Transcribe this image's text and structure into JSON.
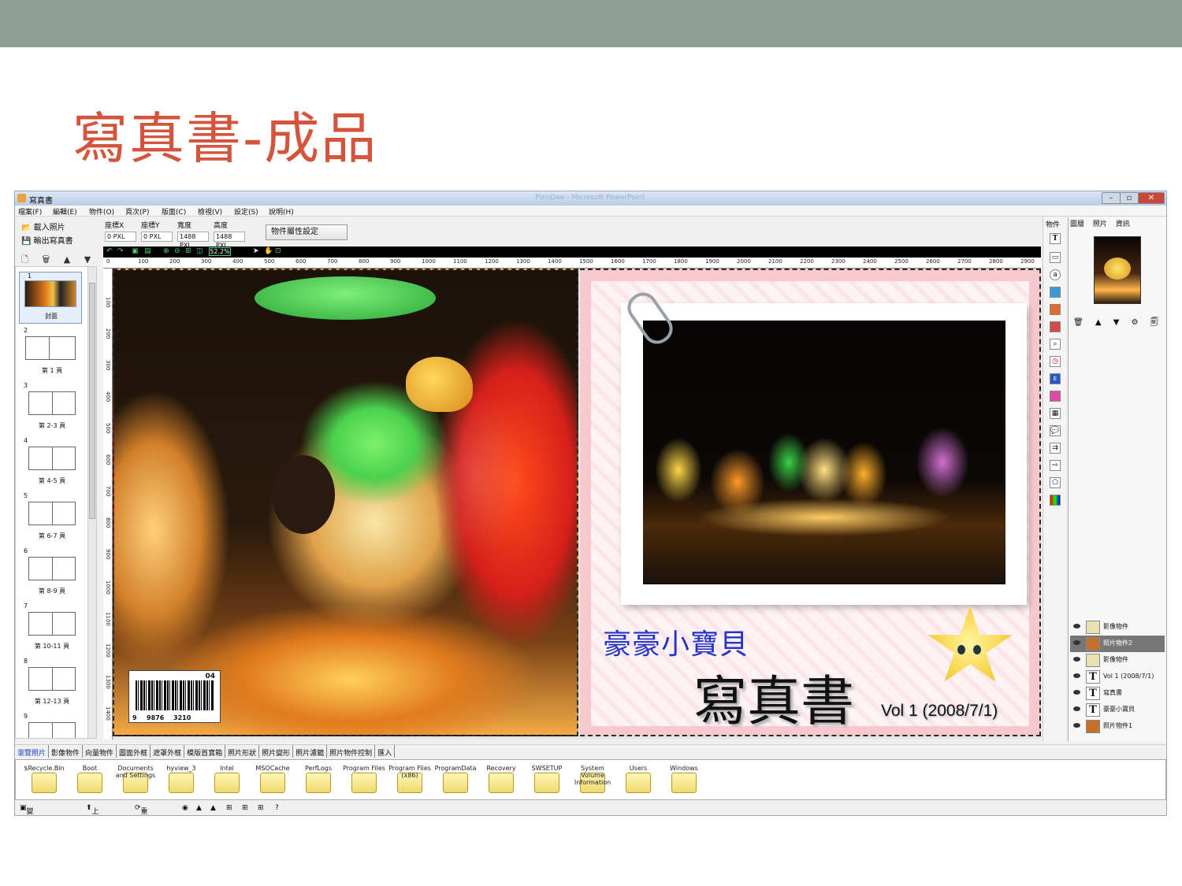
{
  "slide": {
    "title": "寫真書-成品"
  },
  "window": {
    "title": "寫真書",
    "ghost_title": "PlenDae - Microsoft PowerPoint",
    "controls": {
      "minimize": "–",
      "maximize": "▫",
      "close": "✕"
    }
  },
  "menu": [
    "檔案(F)",
    "編輯(E)",
    "物件(O)",
    "頁次(P)",
    "版面(C)",
    "檢視(V)",
    "設定(S)",
    "說明(H)"
  ],
  "left_tools": {
    "load_photo": "載入照片",
    "export_book": "輸出寫真書"
  },
  "thumb_tools": "🗋 🗑 ▲ ▼ ⟳",
  "props": {
    "x": {
      "label": "座標X",
      "value": "0 PXL"
    },
    "y": {
      "label": "座標Y",
      "value": "0 PXL"
    },
    "w": {
      "label": "寬度",
      "value": "1488 PXL"
    },
    "h": {
      "label": "高度",
      "value": "1488 PXL"
    },
    "button": "物件屬性設定"
  },
  "zoom": {
    "percent": "52.2%"
  },
  "ruler_h": [
    "0",
    "100",
    "200",
    "300",
    "400",
    "500",
    "600",
    "700",
    "800",
    "900",
    "1000",
    "1100",
    "1200",
    "1300",
    "1400",
    "1500",
    "1600",
    "1700",
    "1800",
    "1900",
    "2000",
    "2100",
    "2200",
    "2300",
    "2400",
    "2500",
    "2600",
    "2700",
    "2800",
    "2900"
  ],
  "ruler_v": [
    "100",
    "200",
    "300",
    "400",
    "500",
    "600",
    "700",
    "800",
    "900",
    "1000",
    "1100",
    "1200",
    "1300",
    "1400"
  ],
  "pages": [
    {
      "num": "1",
      "label": "封面"
    },
    {
      "num": "2",
      "label": "第 1 頁"
    },
    {
      "num": "3",
      "label": "第 2-3 頁"
    },
    {
      "num": "4",
      "label": "第 4-5 頁"
    },
    {
      "num": "5",
      "label": "第 6-7 頁"
    },
    {
      "num": "6",
      "label": "第 8-9 頁"
    },
    {
      "num": "7",
      "label": "第 10-11 頁"
    },
    {
      "num": "8",
      "label": "第 12-13 頁"
    },
    {
      "num": "9",
      "label": ""
    }
  ],
  "barcode": {
    "top": "04",
    "d1": "9",
    "d2": "9876",
    "d3": "3210"
  },
  "cover_text": {
    "subtitle": "豪豪小寶貝",
    "main": "寫真書",
    "vol": "Vol 1 (2008/7/1)"
  },
  "object_bar": {
    "label": "物件"
  },
  "right_panel": {
    "tabs": [
      "圖層",
      "照片",
      "資訊"
    ],
    "tools": "🗑 ▲ ▼ ⚙ 🗐",
    "layers": [
      {
        "type": "image",
        "name": "影像物件"
      },
      {
        "type": "photo",
        "name": "照片物件2",
        "selected": true
      },
      {
        "type": "image",
        "name": "影像物件"
      },
      {
        "type": "text",
        "name": "Vol 1 (2008/7/1)"
      },
      {
        "type": "text",
        "name": "寫真書"
      },
      {
        "type": "text",
        "name": "豪豪小寶貝"
      },
      {
        "type": "photo",
        "name": "照片物件1"
      }
    ]
  },
  "bottom_tabs": [
    "瀏覽照片",
    "影像物件",
    "向量物件",
    "圖面外框",
    "遮罩外框",
    "模版首寶箱",
    "照片形狀",
    "照片變形",
    "照片濾鏡",
    "照片物件控制",
    "匯入"
  ],
  "folders": [
    "$Recycle.Bin",
    "Boot",
    "Documents and Settings",
    "hyview_3",
    "Intel",
    "MSOCache",
    "PerfLogs",
    "Program Files",
    "Program Files (x86)",
    "ProgramData",
    "Recovery",
    "SWSETUP",
    "System Volume Information",
    "Users",
    "Windows"
  ],
  "statusbar": {
    "change_folder": "變更資料夾",
    "up_level": "上一層",
    "refresh": "重新整理",
    "help": "?"
  },
  "colors": {
    "title": "#d4553c",
    "topbar": "#8e9e97",
    "caption_blue": "#2434c8"
  }
}
